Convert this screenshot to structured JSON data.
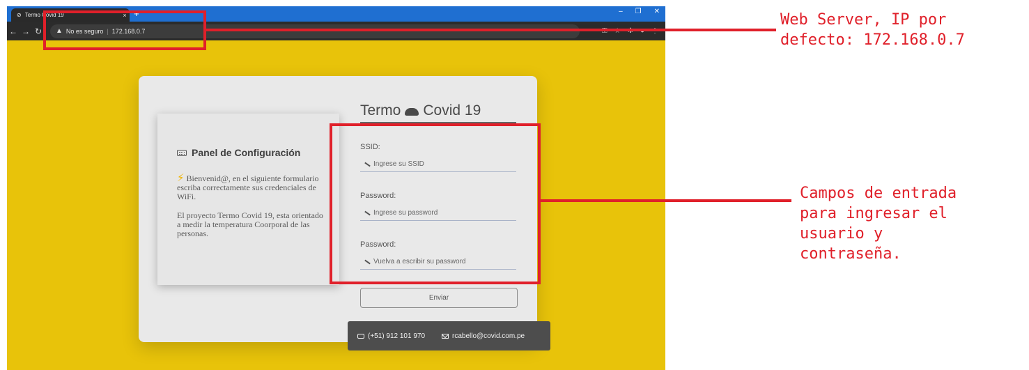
{
  "browser": {
    "tab_title": "Termo Covid 19",
    "tab_close": "×",
    "new_tab": "+",
    "security_warning": "No es seguro",
    "address": "172.168.0.7",
    "minimize": "–",
    "maximize": "❐",
    "close": "✕"
  },
  "page": {
    "brand_left": "Termo",
    "brand_right": "Covid 19",
    "panel_title": "Panel de Configuración",
    "intro_text": "Bienvenid@, en el siguiente formulario escriba correctamente sus credenciales de WiFi.",
    "project_text": "El proyecto Termo Covid 19, esta orientado a medir la temperatura Coorporal de las personas.",
    "fields": [
      {
        "label": "SSID:",
        "placeholder": "Ingrese su SSID"
      },
      {
        "label": "Password:",
        "placeholder": "Ingrese su password"
      },
      {
        "label": "Password:",
        "placeholder": "Vuelva a escribir su password"
      }
    ],
    "submit_label": "Enviar",
    "contact": {
      "phone": "(+51) 912 101 970",
      "email": "rcabello@covid.com.pe"
    }
  },
  "annotations": {
    "server_note": "Web Server, IP por\ndefecto: 172.168.0.7",
    "fields_note": "Campos de entrada\npara ingresar el\nusuario y\ncontraseña.",
    "color": "#e0202a"
  },
  "colors": {
    "page_background": "#e8c30a",
    "card_background": "#e9e9e9",
    "footer_background": "#4d4d4d"
  }
}
